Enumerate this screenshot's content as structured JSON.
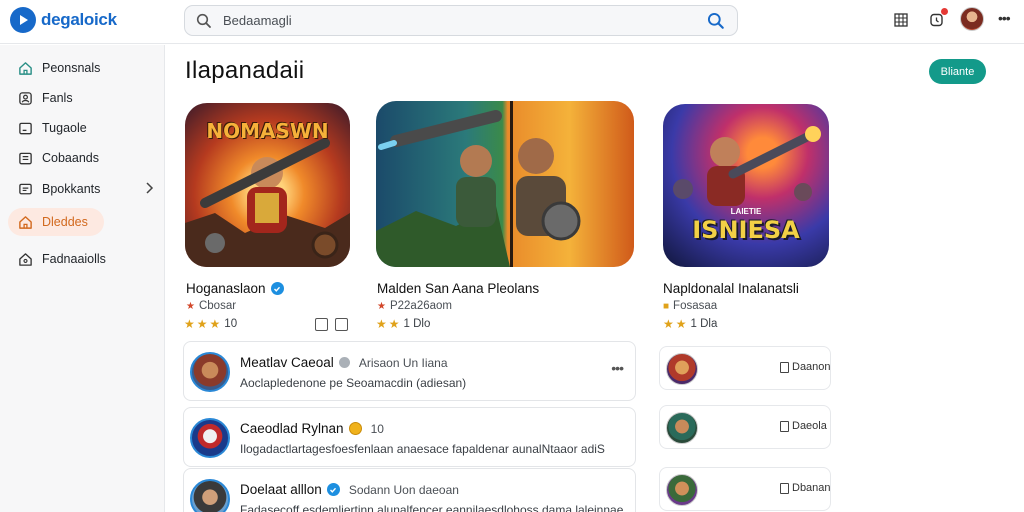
{
  "header": {
    "logo_text": "degaloick",
    "search_value": "Bedaamagli",
    "search_placeholder": "Bedaamagli",
    "icons": [
      "logo-play-icon",
      "search-icon",
      "grid-icon",
      "notification-bell-icon",
      "user-avatar",
      "more-horizontal-icon"
    ],
    "colors": {
      "brand": "#1769c9",
      "notification_dot": "#e53935"
    }
  },
  "sidebar": {
    "items": [
      {
        "label": "Peonsnals",
        "icon": "home-icon"
      },
      {
        "label": "Fanls",
        "icon": "people-icon"
      },
      {
        "label": "Tugaole",
        "icon": "monitor-icon"
      },
      {
        "label": "Cobaands",
        "icon": "list-icon"
      },
      {
        "label": "Bpokkants",
        "icon": "chat-icon",
        "has_chevron": true
      },
      {
        "label": "Dleddes",
        "icon": "house-icon",
        "active": true
      },
      {
        "label": "Fadnaaiolls",
        "icon": "tag-icon"
      }
    ],
    "colors": {
      "active_bg": "#fde9e1",
      "active_text": "#d2691e"
    }
  },
  "main": {
    "title": "Ilapanadaii",
    "filter_label": "Bliante",
    "colors": {
      "filter_bg": "#139a8a"
    },
    "cards": [
      {
        "title": "Hoganaslaon",
        "verified": true,
        "tile_text": "NOMASWN",
        "sub": "Cbosar",
        "rating_text": "10",
        "stars": 3
      },
      {
        "title": "Malden San Aana Pleolans",
        "verified": false,
        "tile_text": "",
        "sub": "P22a26aom",
        "rating_text": "1 Dlo",
        "stars": 2
      },
      {
        "title": "Napldonalal Inalanatsli",
        "verified": false,
        "tile_text": "ISNIESA",
        "tile_sub_text": "LAIETIE",
        "sub": "Fosasaa",
        "rating_text": "1 Dla",
        "stars": 2
      }
    ],
    "comments": [
      {
        "name": "Meatlav Caeoal",
        "badge": "gray",
        "meta": "Arisaon Un Iiana",
        "body": "Aoclapledenone pe Seoamacdin (adiesan)",
        "has_more": true
      },
      {
        "name": "Caeodlad Rylnan",
        "badge": "coin",
        "meta": "10",
        "body": "Ilogadactlartagesfoesfenlaan anaesace fapaldenar aunalNtaaor adiS",
        "has_more": false
      },
      {
        "name": "Doelaat alllon",
        "badge": "verified",
        "meta": "Sodann Uon daeoan",
        "body": "Fadasecoff esdemliertinn alunalfencer eannilaesdlohoss dama laleinnae",
        "has_more": false
      }
    ],
    "side_list": [
      {
        "label": "Daanon"
      },
      {
        "label": "Daeola"
      },
      {
        "label": "Dbanan"
      }
    ]
  }
}
